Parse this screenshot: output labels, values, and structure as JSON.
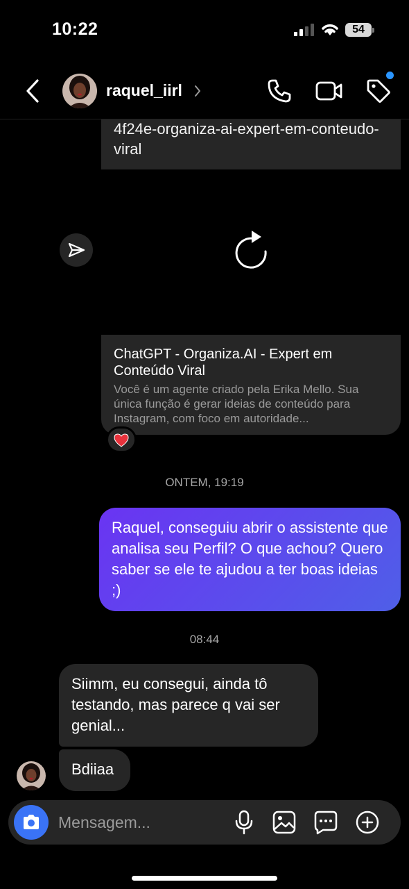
{
  "status_bar": {
    "time": "10:22",
    "battery": "54",
    "icons": [
      "signal-icon",
      "wifi-icon",
      "battery-icon"
    ]
  },
  "header": {
    "username": "raquel_iirl",
    "icons": [
      "back-icon",
      "chevron-right-icon",
      "phone-icon",
      "video-icon",
      "tag-icon"
    ],
    "notification_color": "#2a95ff"
  },
  "messages": {
    "link_top": "4f24e-organiza-ai-expert-em-conteudo-viral",
    "link_card": {
      "title": "ChatGPT - Organiza.AI - Expert em Conteúdo Viral",
      "description": "Você é um agente criado pela Erika Mello. Sua única função é gerar ideias de conteúdo para Instagram, com foco em autoridade..."
    },
    "reaction": "❤️",
    "timestamp_1": "ONTEM, 19:19",
    "outgoing_1": "Raquel, conseguiu abrir o assistente que analisa seu Perfil? O que achou? Quero saber se ele te ajudou a ter boas ideias ;)",
    "timestamp_2": "08:44",
    "incoming_1": "Siimm, eu consegui, ainda tô testando, mas parece q vai ser genial...",
    "incoming_2": "Bdiiaa"
  },
  "composer": {
    "placeholder": "Mensagem...",
    "icons": [
      "camera-icon",
      "microphone-icon",
      "gallery-icon",
      "sticker-icon",
      "plus-icon"
    ],
    "camera_color": "#3a73f6"
  },
  "colors": {
    "background": "#000000",
    "bubble_incoming": "#262626",
    "bubble_outgoing_start": "#6a34f2",
    "bubble_outgoing_end": "#4f5fe8"
  }
}
